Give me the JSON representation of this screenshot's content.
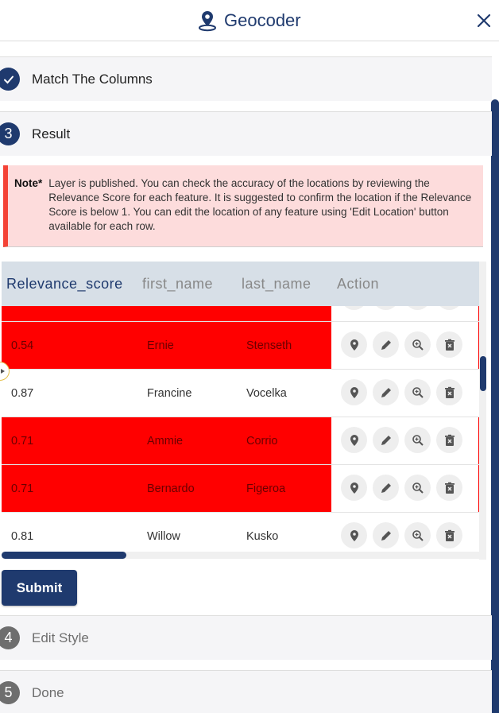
{
  "header": {
    "title": "Geocoder",
    "icon": "map-pin-icon",
    "close_icon": "close-icon"
  },
  "steps": [
    {
      "badge": "✓",
      "label": "Match The Columns",
      "state": "completed"
    },
    {
      "badge": "3",
      "label": "Result",
      "state": "active"
    },
    {
      "badge": "4",
      "label": "Edit Style",
      "state": "inactive"
    },
    {
      "badge": "5",
      "label": "Done",
      "state": "inactive"
    }
  ],
  "note": {
    "label": "Note*",
    "text": "Layer is published. You can check the accuracy of the locations by reviewing the Relevance Score for each feature. It is suggested to confirm the location if the Relevance Score is below 1. You can edit the location of any feature using 'Edit Location' button available for each row."
  },
  "table": {
    "columns": [
      "Relevance_score",
      "first_name",
      "last_name",
      "Action"
    ],
    "rows": [
      {
        "score": "0.54",
        "first_name": "Ernie",
        "last_name": "Stenseth",
        "highlighted": true
      },
      {
        "score": "0.87",
        "first_name": "Francine",
        "last_name": "Vocelka",
        "highlighted": false
      },
      {
        "score": "0.71",
        "first_name": "Ammie",
        "last_name": "Corrio",
        "highlighted": true
      },
      {
        "score": "0.71",
        "first_name": "Bernardo",
        "last_name": "Figeroa",
        "highlighted": true
      },
      {
        "score": "0.81",
        "first_name": "Willow",
        "last_name": "Kusko",
        "highlighted": false
      }
    ],
    "actions": [
      "locate-icon",
      "edit-icon",
      "zoom-in-icon",
      "delete-icon"
    ],
    "highlight_color": "#ff0000"
  },
  "submit_label": "Submit",
  "colors": {
    "primary": "#1f3a6e",
    "note_bg": "#fddcdc",
    "note_border": "#f44336"
  }
}
